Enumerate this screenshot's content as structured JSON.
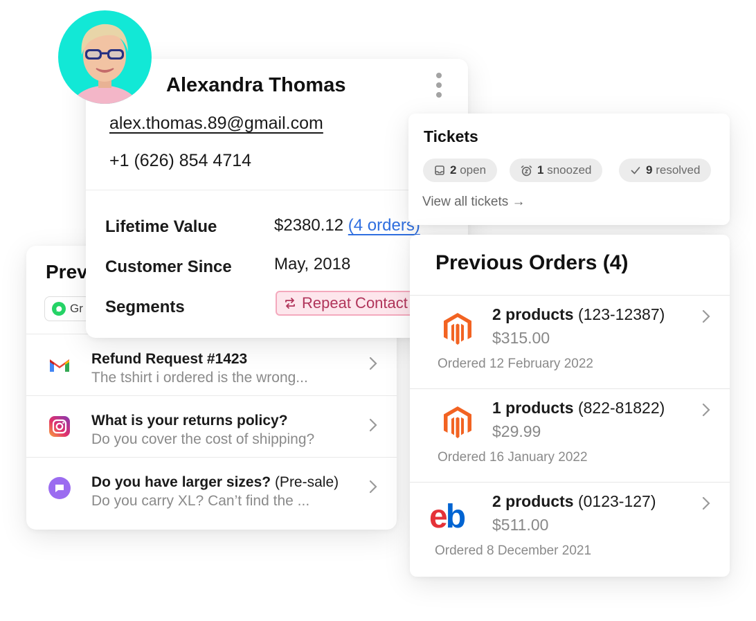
{
  "customer": {
    "name": "Alexandra Thomas",
    "email": "alex.thomas.89@gmail.com",
    "phone": "+1 (626) 854 4714",
    "lifetime_label": "Lifetime Value",
    "lifetime_value": "$2380.12",
    "orders_link": "(4 orders)",
    "since_label": "Customer Since",
    "since_value": "May, 2018",
    "segments_label": "Segments",
    "segment": "Repeat Contact",
    "menu_icon": "kebab-menu-icon"
  },
  "conversations": {
    "title": "Prev",
    "channel_chip": "Gr",
    "items": [
      {
        "icon": "gmail-icon",
        "title": "Refund Request #1423",
        "suffix": "",
        "preview": "The tshirt i ordered is the wrong..."
      },
      {
        "icon": "instagram-icon",
        "title": "What is your returns policy?",
        "suffix": "",
        "preview": "Do you cover the cost of shipping?"
      },
      {
        "icon": "chat-icon",
        "title": "Do you have larger sizes?",
        "suffix": " (Pre-sale)",
        "preview": "Do you carry XL? Can’t find the ..."
      }
    ]
  },
  "tickets": {
    "title": "Tickets",
    "open_count": "2",
    "open_label": "open",
    "snoozed_count": "1",
    "snoozed_label": "snoozed",
    "resolved_count": "9",
    "resolved_label": "resolved",
    "view_all": "View all tickets →"
  },
  "orders": {
    "title": "Previous Orders (4)",
    "items": [
      {
        "logo": "magento-logo",
        "products": "2 products",
        "code": " (123-12387)",
        "price": "$315.00",
        "date": "Ordered 12 February 2022"
      },
      {
        "logo": "magento-logo",
        "products": "1 products",
        "code": " (822-81822)",
        "price": "$29.99",
        "date": "Ordered 16 January 2022"
      },
      {
        "logo": "ebay-logo",
        "logo_text": "eb",
        "products": "2 products",
        "code": " (0123-127)",
        "price": "$511.00",
        "date": "Ordered 8 December 2021"
      }
    ]
  },
  "colors": {
    "avatar_bg": "#12e8d6",
    "link": "#2f6fe0",
    "segment_text": "#b0345a",
    "segment_bg": "#fde6ec",
    "magento": "#f26322",
    "ebay_e": "#e53238",
    "ebay_b": "#0064d2"
  }
}
